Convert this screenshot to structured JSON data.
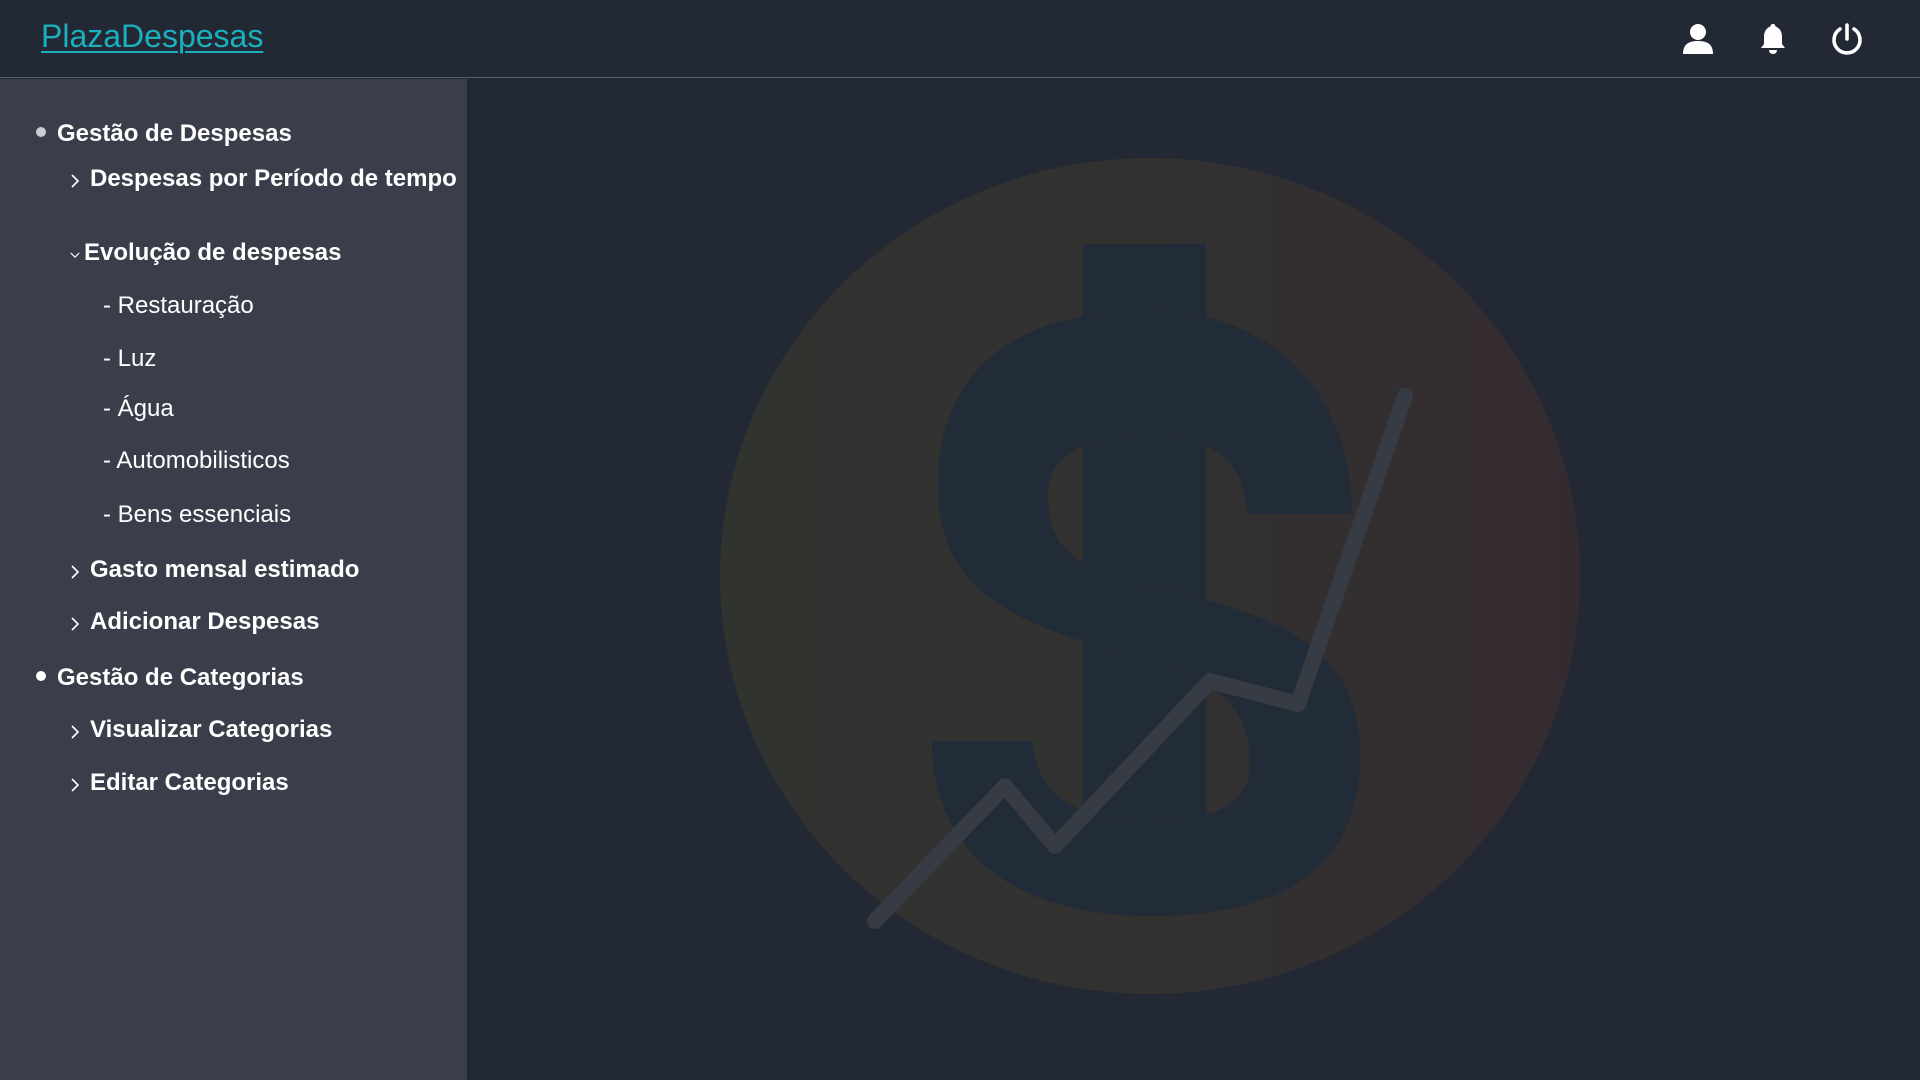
{
  "header": {
    "brand": "PlazaDespesas",
    "icons": [
      "user-icon",
      "bell-icon",
      "power-icon"
    ]
  },
  "sidebar": {
    "sections": [
      {
        "title": "Gestão de Despesas",
        "items": [
          {
            "label": "Despesas por Período de tempo",
            "state": "collapsed"
          },
          {
            "label": "Evolução de despesas",
            "state": "expanded",
            "children": [
              "- Restauração",
              "- Luz",
              "- Água",
              "- Automobilisticos",
              "- Bens essenciais"
            ]
          },
          {
            "label": "Gasto mensal estimado",
            "state": "collapsed"
          },
          {
            "label": "Adicionar Despesas",
            "state": "collapsed"
          }
        ]
      },
      {
        "title": "Gestão de Categorias",
        "items": [
          {
            "label": "Visualizar Categorias",
            "state": "collapsed"
          },
          {
            "label": "Editar Categorias",
            "state": "collapsed"
          }
        ]
      }
    ]
  },
  "colors": {
    "brand": "#1ab0bd",
    "background": "#222834",
    "sidebar": "#393e4a"
  }
}
